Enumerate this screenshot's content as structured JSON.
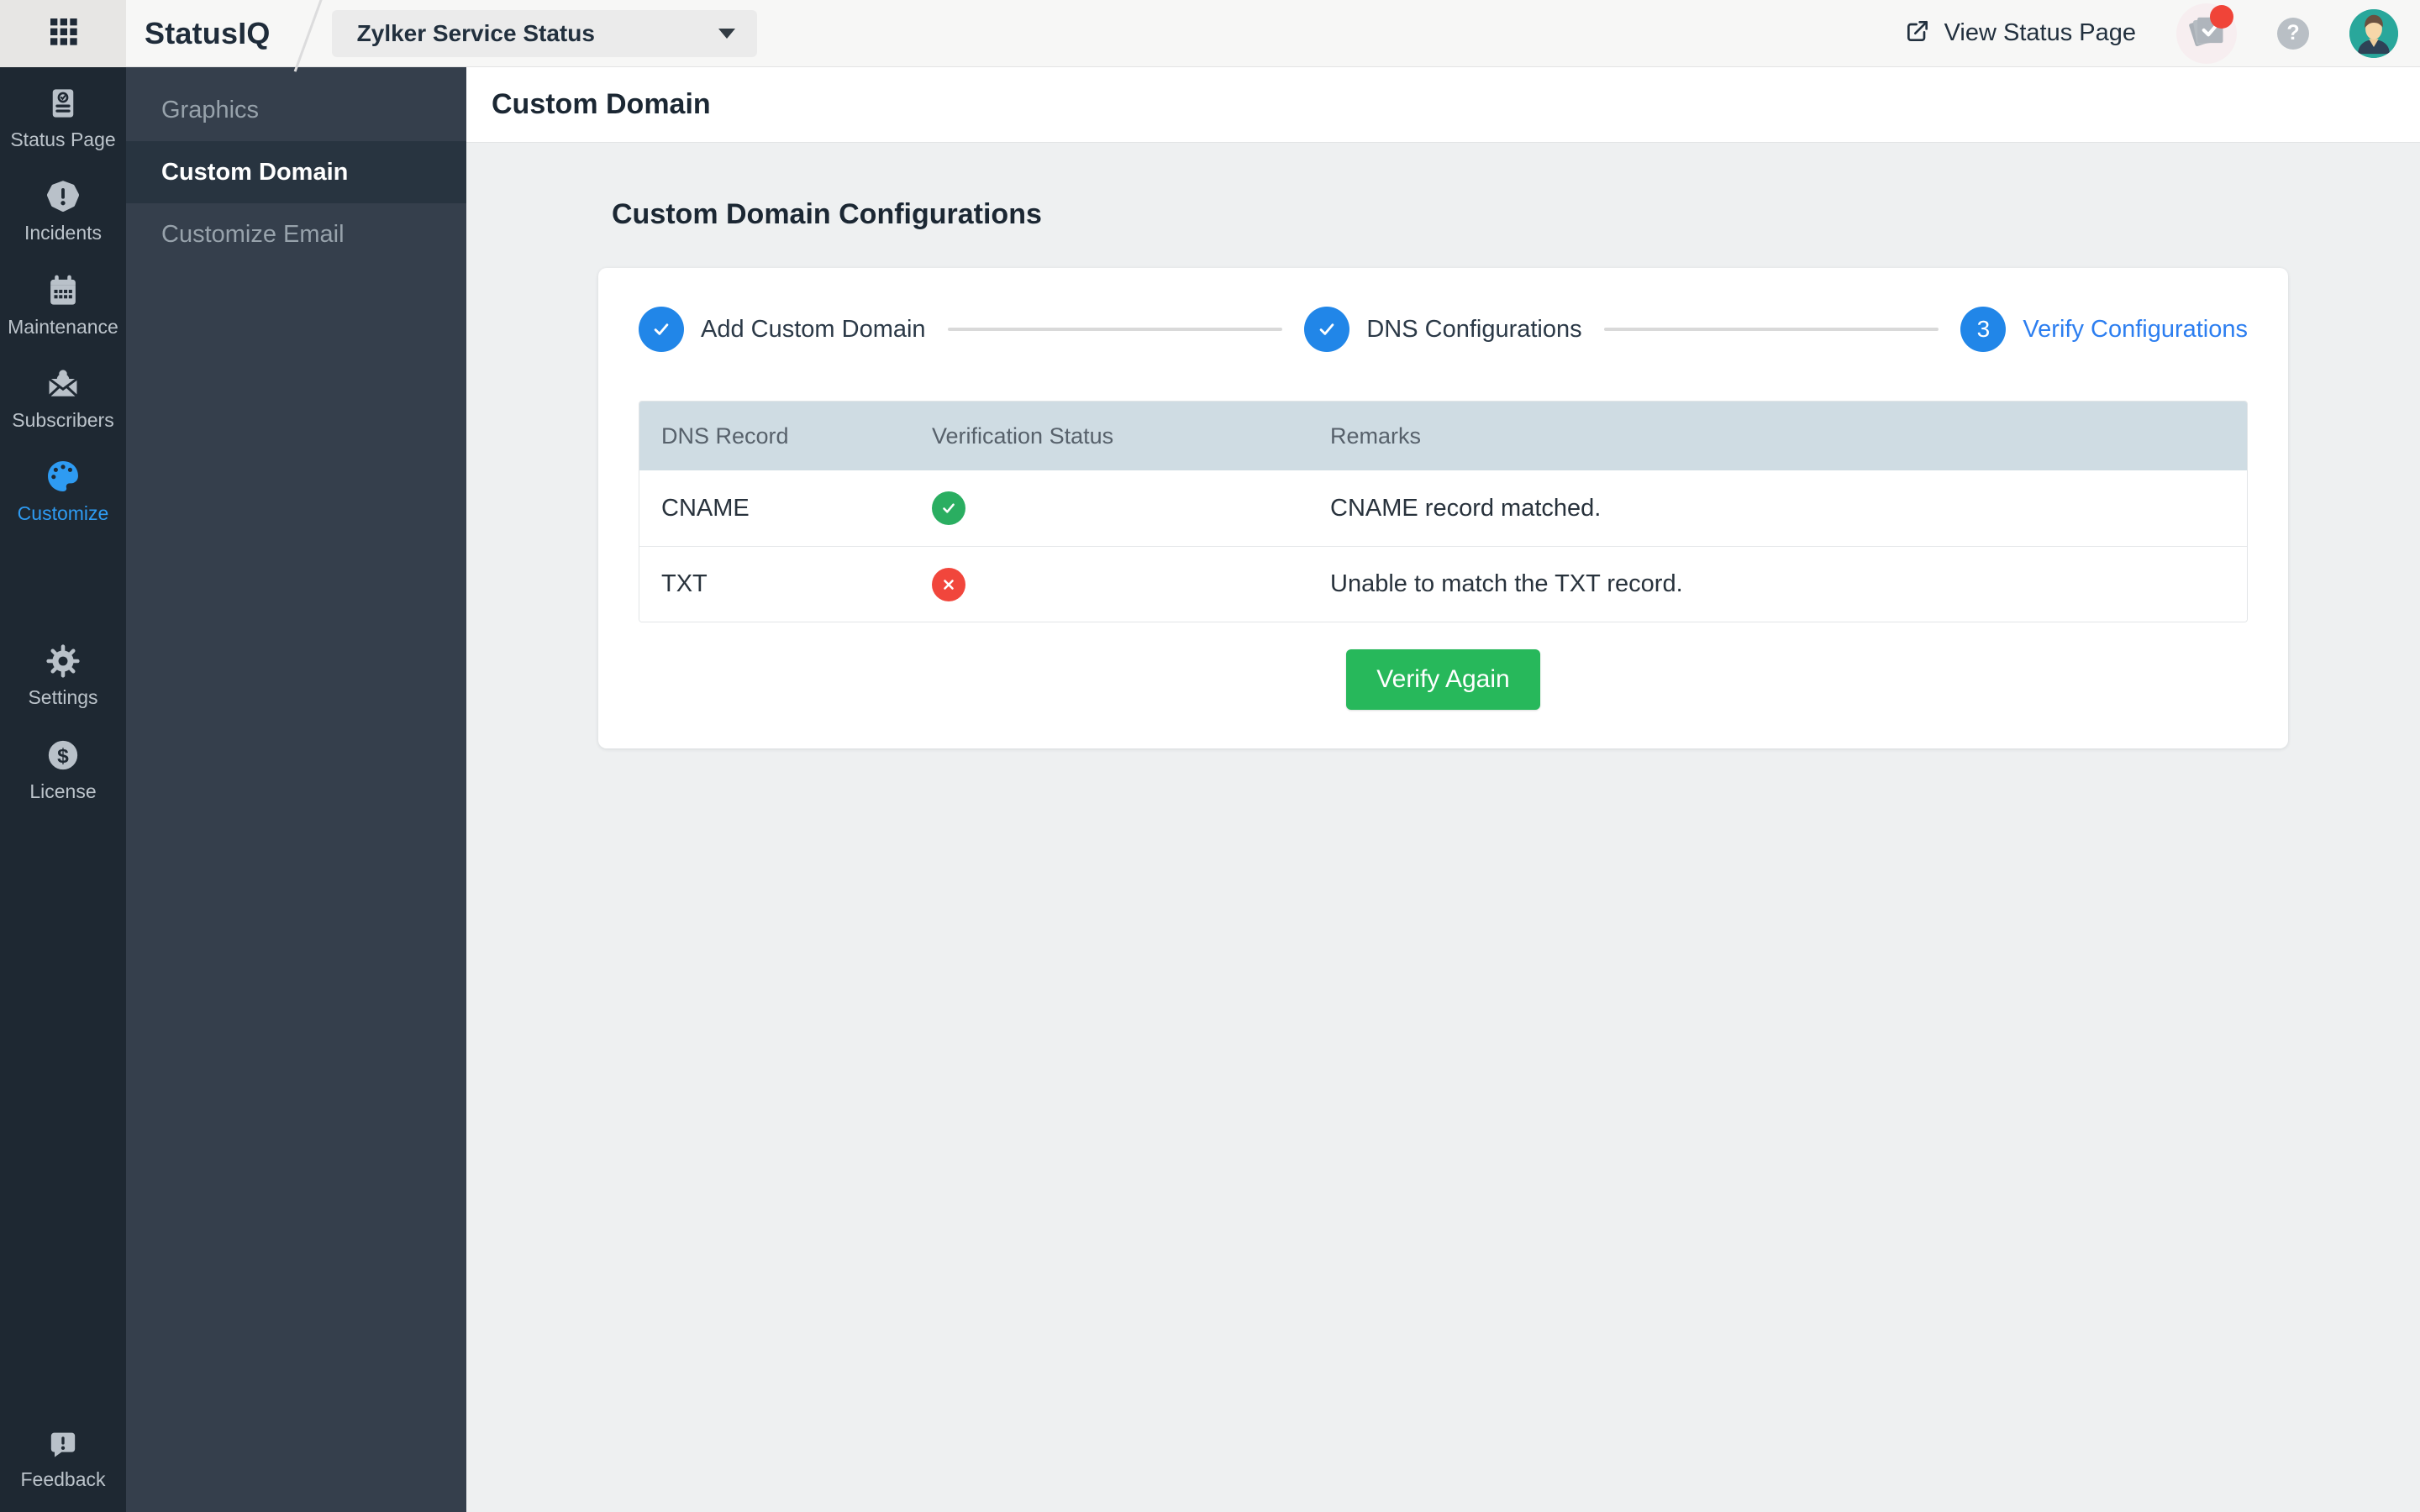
{
  "topbar": {
    "product_name": "StatusIQ",
    "status_page_selector": {
      "value": "Zylker Service Status"
    },
    "view_status_page_label": "View Status Page",
    "help_glyph": "?",
    "notification_badge_visible": true,
    "icons": [
      "apps-grid-icon",
      "external-link-icon",
      "status-notifications-icon",
      "help-icon",
      "user-avatar"
    ]
  },
  "primary_sidebar": {
    "items": [
      {
        "label": "Status Page",
        "icon": "status-page-icon",
        "active": false
      },
      {
        "label": "Incidents",
        "icon": "incidents-icon",
        "active": false
      },
      {
        "label": "Maintenance",
        "icon": "maintenance-icon",
        "active": false
      },
      {
        "label": "Subscribers",
        "icon": "subscribers-icon",
        "active": false
      },
      {
        "label": "Customize",
        "icon": "customize-palette-icon",
        "active": true
      },
      {
        "label": "Settings",
        "icon": "settings-gear-icon",
        "active": false
      },
      {
        "label": "License",
        "icon": "license-dollar-icon",
        "active": false
      }
    ],
    "footer_item": {
      "label": "Feedback",
      "icon": "feedback-icon"
    }
  },
  "secondary_sidebar": {
    "items": [
      {
        "label": "Graphics",
        "active": false
      },
      {
        "label": "Custom Domain",
        "active": true
      },
      {
        "label": "Customize Email",
        "active": false
      }
    ]
  },
  "main": {
    "page_title": "Custom Domain",
    "section_title": "Custom Domain Configurations",
    "stepper": {
      "steps": [
        {
          "label": "Add Custom Domain",
          "state": "done"
        },
        {
          "label": "DNS Configurations",
          "state": "done"
        },
        {
          "label": "Verify Configurations",
          "state": "current",
          "number": "3"
        }
      ]
    },
    "table": {
      "columns": {
        "record": "DNS Record",
        "status": "Verification Status",
        "remarks": "Remarks"
      },
      "rows": [
        {
          "record": "CNAME",
          "status": "success",
          "remarks": "CNAME record matched."
        },
        {
          "record": "TXT",
          "status": "error",
          "remarks": "Unable to match the TXT record."
        }
      ]
    },
    "verify_button_label": "Verify Again"
  },
  "colors": {
    "accent_blue": "#2186e8",
    "link_blue": "#2c7ef0",
    "success_green": "#2aae61",
    "error_red": "#f1463c",
    "button_green": "#27b85b",
    "notification_badge_red": "#f04438",
    "avatar_teal": "#29a79b",
    "sidebar_dark": "#1e2832",
    "sidebar_slate": "#353f4c",
    "table_header_bg": "#cfdce3"
  }
}
